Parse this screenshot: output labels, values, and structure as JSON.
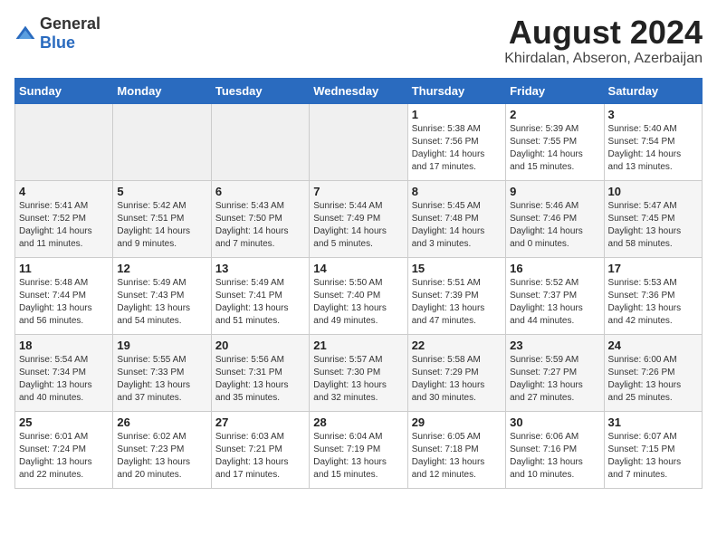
{
  "header": {
    "logo_general": "General",
    "logo_blue": "Blue",
    "month_year": "August 2024",
    "location": "Khirdalan, Abseron, Azerbaijan"
  },
  "days_of_week": [
    "Sunday",
    "Monday",
    "Tuesday",
    "Wednesday",
    "Thursday",
    "Friday",
    "Saturday"
  ],
  "weeks": [
    [
      {
        "day": null,
        "info": ""
      },
      {
        "day": null,
        "info": ""
      },
      {
        "day": null,
        "info": ""
      },
      {
        "day": null,
        "info": ""
      },
      {
        "day": "1",
        "info": "Sunrise: 5:38 AM\nSunset: 7:56 PM\nDaylight: 14 hours\nand 17 minutes."
      },
      {
        "day": "2",
        "info": "Sunrise: 5:39 AM\nSunset: 7:55 PM\nDaylight: 14 hours\nand 15 minutes."
      },
      {
        "day": "3",
        "info": "Sunrise: 5:40 AM\nSunset: 7:54 PM\nDaylight: 14 hours\nand 13 minutes."
      }
    ],
    [
      {
        "day": "4",
        "info": "Sunrise: 5:41 AM\nSunset: 7:52 PM\nDaylight: 14 hours\nand 11 minutes."
      },
      {
        "day": "5",
        "info": "Sunrise: 5:42 AM\nSunset: 7:51 PM\nDaylight: 14 hours\nand 9 minutes."
      },
      {
        "day": "6",
        "info": "Sunrise: 5:43 AM\nSunset: 7:50 PM\nDaylight: 14 hours\nand 7 minutes."
      },
      {
        "day": "7",
        "info": "Sunrise: 5:44 AM\nSunset: 7:49 PM\nDaylight: 14 hours\nand 5 minutes."
      },
      {
        "day": "8",
        "info": "Sunrise: 5:45 AM\nSunset: 7:48 PM\nDaylight: 14 hours\nand 3 minutes."
      },
      {
        "day": "9",
        "info": "Sunrise: 5:46 AM\nSunset: 7:46 PM\nDaylight: 14 hours\nand 0 minutes."
      },
      {
        "day": "10",
        "info": "Sunrise: 5:47 AM\nSunset: 7:45 PM\nDaylight: 13 hours\nand 58 minutes."
      }
    ],
    [
      {
        "day": "11",
        "info": "Sunrise: 5:48 AM\nSunset: 7:44 PM\nDaylight: 13 hours\nand 56 minutes."
      },
      {
        "day": "12",
        "info": "Sunrise: 5:49 AM\nSunset: 7:43 PM\nDaylight: 13 hours\nand 54 minutes."
      },
      {
        "day": "13",
        "info": "Sunrise: 5:49 AM\nSunset: 7:41 PM\nDaylight: 13 hours\nand 51 minutes."
      },
      {
        "day": "14",
        "info": "Sunrise: 5:50 AM\nSunset: 7:40 PM\nDaylight: 13 hours\nand 49 minutes."
      },
      {
        "day": "15",
        "info": "Sunrise: 5:51 AM\nSunset: 7:39 PM\nDaylight: 13 hours\nand 47 minutes."
      },
      {
        "day": "16",
        "info": "Sunrise: 5:52 AM\nSunset: 7:37 PM\nDaylight: 13 hours\nand 44 minutes."
      },
      {
        "day": "17",
        "info": "Sunrise: 5:53 AM\nSunset: 7:36 PM\nDaylight: 13 hours\nand 42 minutes."
      }
    ],
    [
      {
        "day": "18",
        "info": "Sunrise: 5:54 AM\nSunset: 7:34 PM\nDaylight: 13 hours\nand 40 minutes."
      },
      {
        "day": "19",
        "info": "Sunrise: 5:55 AM\nSunset: 7:33 PM\nDaylight: 13 hours\nand 37 minutes."
      },
      {
        "day": "20",
        "info": "Sunrise: 5:56 AM\nSunset: 7:31 PM\nDaylight: 13 hours\nand 35 minutes."
      },
      {
        "day": "21",
        "info": "Sunrise: 5:57 AM\nSunset: 7:30 PM\nDaylight: 13 hours\nand 32 minutes."
      },
      {
        "day": "22",
        "info": "Sunrise: 5:58 AM\nSunset: 7:29 PM\nDaylight: 13 hours\nand 30 minutes."
      },
      {
        "day": "23",
        "info": "Sunrise: 5:59 AM\nSunset: 7:27 PM\nDaylight: 13 hours\nand 27 minutes."
      },
      {
        "day": "24",
        "info": "Sunrise: 6:00 AM\nSunset: 7:26 PM\nDaylight: 13 hours\nand 25 minutes."
      }
    ],
    [
      {
        "day": "25",
        "info": "Sunrise: 6:01 AM\nSunset: 7:24 PM\nDaylight: 13 hours\nand 22 minutes."
      },
      {
        "day": "26",
        "info": "Sunrise: 6:02 AM\nSunset: 7:23 PM\nDaylight: 13 hours\nand 20 minutes."
      },
      {
        "day": "27",
        "info": "Sunrise: 6:03 AM\nSunset: 7:21 PM\nDaylight: 13 hours\nand 17 minutes."
      },
      {
        "day": "28",
        "info": "Sunrise: 6:04 AM\nSunset: 7:19 PM\nDaylight: 13 hours\nand 15 minutes."
      },
      {
        "day": "29",
        "info": "Sunrise: 6:05 AM\nSunset: 7:18 PM\nDaylight: 13 hours\nand 12 minutes."
      },
      {
        "day": "30",
        "info": "Sunrise: 6:06 AM\nSunset: 7:16 PM\nDaylight: 13 hours\nand 10 minutes."
      },
      {
        "day": "31",
        "info": "Sunrise: 6:07 AM\nSunset: 7:15 PM\nDaylight: 13 hours\nand 7 minutes."
      }
    ]
  ]
}
